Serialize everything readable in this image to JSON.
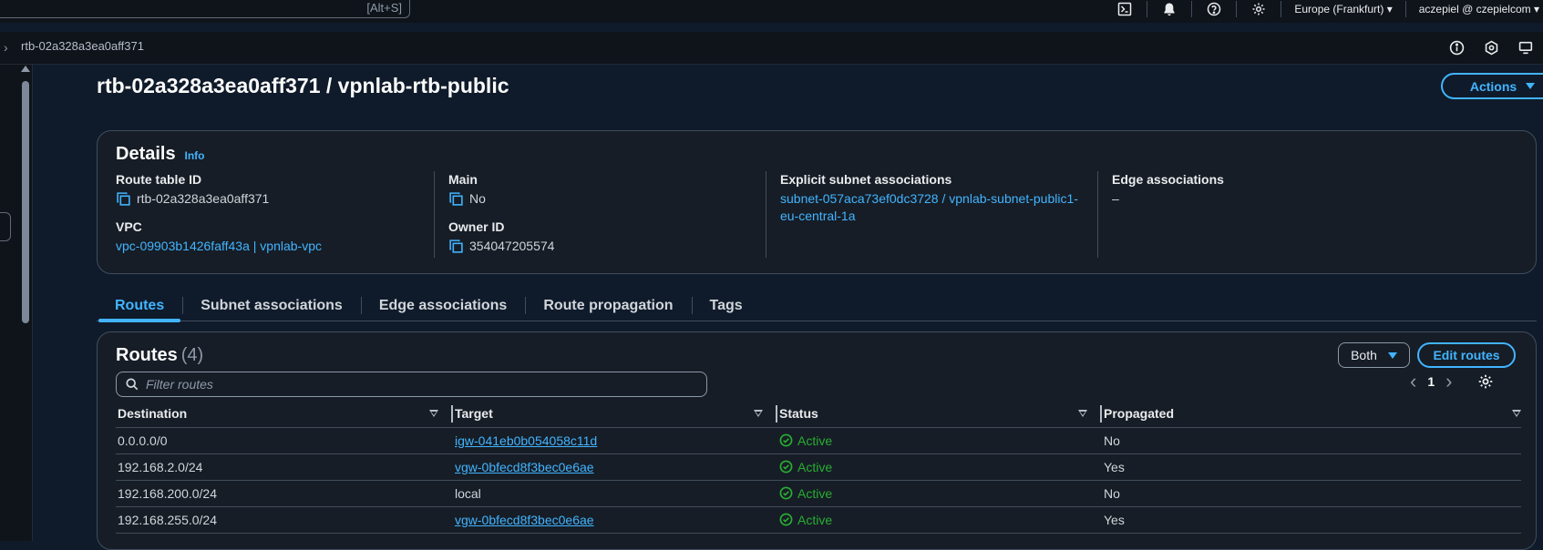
{
  "topbar": {
    "shortcut": "[Alt+S]",
    "region": "Europe (Frankfurt) ▾",
    "account": "aczepiel @ czepielcom ▾"
  },
  "breadcrumb": {
    "current": "rtb-02a328a3ea0aff371"
  },
  "page": {
    "title": "rtb-02a328a3ea0aff371 / vpnlab-rtb-public",
    "actions_label": "Actions"
  },
  "details": {
    "heading": "Details",
    "info": "Info",
    "route_table_id_label": "Route table ID",
    "route_table_id": "rtb-02a328a3ea0aff371",
    "vpc_label": "VPC",
    "vpc": "vpc-09903b1426faff43a | vpnlab-vpc",
    "main_label": "Main",
    "main": "No",
    "owner_label": "Owner ID",
    "owner": "354047205574",
    "subnet_label": "Explicit subnet associations",
    "subnet_line1": "subnet-057aca73ef0dc3728 / vpnlab-subnet-public1-",
    "subnet_line2": "eu-central-1a",
    "edge_label": "Edge associations",
    "edge": "–"
  },
  "tabs": [
    "Routes",
    "Subnet associations",
    "Edge associations",
    "Route propagation",
    "Tags"
  ],
  "routes": {
    "heading": "Routes",
    "count": "(4)",
    "both_label": "Both",
    "edit_label": "Edit routes",
    "filter_placeholder": "Filter routes",
    "page": "1",
    "columns": [
      "Destination",
      "Target",
      "Status",
      "Propagated"
    ],
    "rows": [
      {
        "destination": "0.0.0.0/0",
        "target": "igw-041eb0b054058c11d",
        "target_link": true,
        "status": "Active",
        "propagated": "No"
      },
      {
        "destination": "192.168.2.0/24",
        "target": "vgw-0bfecd8f3bec0e6ae",
        "target_link": true,
        "status": "Active",
        "propagated": "Yes"
      },
      {
        "destination": "192.168.200.0/24",
        "target": "local",
        "target_link": false,
        "status": "Active",
        "propagated": "No"
      },
      {
        "destination": "192.168.255.0/24",
        "target": "vgw-0bfecd8f3bec0e6ae",
        "target_link": true,
        "status": "Active",
        "propagated": "Yes"
      }
    ]
  },
  "colors": {
    "accent": "#42b4ff",
    "success": "#29ad32",
    "background": "#0f1b2a",
    "panel": "#161d26"
  }
}
